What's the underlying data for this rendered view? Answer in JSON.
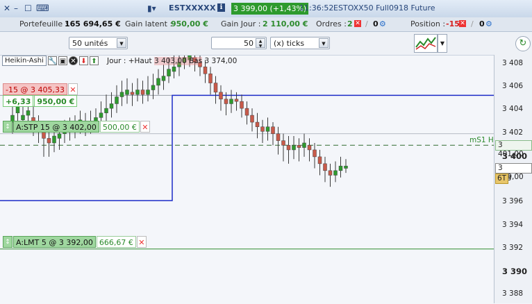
{
  "titlebar": {
    "close_glyph": "✕",
    "minimize_glyph": "–",
    "maximize_glyph": "☐",
    "keyboard_glyph": "⌨",
    "instrument": "ESTXXXXX",
    "info_glyph": "ℹ",
    "price": "3 399,00 (+1,43%)",
    "time": "11:36:52",
    "contract": "ESTOXX50 Full0918 Future"
  },
  "account": {
    "portfolio_label": "Portefeuille :",
    "portfolio_value": "165 694,65 €",
    "latent_label": "Gain latent :",
    "latent_value": "950,00 €",
    "day_label": "Gain Jour :",
    "day_value": "2 110,00 €",
    "orders_label": "Ordres :",
    "orders_pending": "2",
    "orders_done": "0",
    "position_label": "Position :",
    "position_value": "-15",
    "position_done": "0",
    "slash": "/"
  },
  "toolbar": {
    "timeframe_value": "50 unités",
    "ticks_value": "50",
    "ticks_mode": "(x) ticks"
  },
  "chart_header": {
    "style": "Heikin-Ashi",
    "ohlc_prefix": "Jour :",
    "ohlc_high": "+Haut",
    "ohlc_overlap": "3 403,00 Bas",
    "ohlc_low": "3 374,00"
  },
  "orders": {
    "position_tag": "-15 @ 3 405,33",
    "position_points": "+6,33",
    "position_gain": "950,00 €",
    "stop_label": "A:STP  15 @ 3 402,00",
    "stop_gain": "500,00 €",
    "limit_label": "A:LMT  5 @ 3 392,00",
    "limit_gain": "666,67 €"
  },
  "indicator_label": "mS1 H",
  "price_markers": {
    "ms1": "3 401,00",
    "last": "3 399,00",
    "timer": "6T"
  },
  "yaxis_ticks": [
    {
      "label": "3 408",
      "bold": false
    },
    {
      "label": "3 406",
      "bold": false
    },
    {
      "label": "3 404",
      "bold": false
    },
    {
      "label": "3 402",
      "bold": false
    },
    {
      "label": "3 400",
      "bold": true
    },
    {
      "label": "98",
      "bold": false
    },
    {
      "label": "3 396",
      "bold": false
    },
    {
      "label": "3 394",
      "bold": false
    },
    {
      "label": "3 392",
      "bold": false
    },
    {
      "label": "3 390",
      "bold": true
    },
    {
      "label": "3 388",
      "bold": false
    }
  ],
  "colors": {
    "up": "#2e9a2e",
    "down": "#c85a4a",
    "position_line": "#1c2cc8",
    "order_line": "#2e8b2e",
    "accent_green": "#2d9a2d"
  },
  "chart_data": {
    "type": "candlestick",
    "y_unit": "index points",
    "ylim": [
      3387.6,
      3409.0
    ],
    "candles": [
      {
        "o": 3403.0,
        "c": 3403.6,
        "h": 3404.6,
        "l": 3402.0
      },
      {
        "o": 3403.8,
        "c": 3404.4,
        "h": 3405.4,
        "l": 3402.6
      },
      {
        "o": 3403.2,
        "c": 3403.6,
        "h": 3404.8,
        "l": 3402.4
      },
      {
        "o": 3403.6,
        "c": 3404.0,
        "h": 3404.6,
        "l": 3402.6
      },
      {
        "o": 3403.4,
        "c": 3402.8,
        "h": 3404.4,
        "l": 3401.8
      },
      {
        "o": 3402.8,
        "c": 3402.2,
        "h": 3403.6,
        "l": 3401.2
      },
      {
        "o": 3402.2,
        "c": 3401.6,
        "h": 3403.0,
        "l": 3400.0
      },
      {
        "o": 3401.6,
        "c": 3401.2,
        "h": 3402.4,
        "l": 3400.0
      },
      {
        "o": 3401.2,
        "c": 3401.8,
        "h": 3402.8,
        "l": 3400.4
      },
      {
        "o": 3401.6,
        "c": 3402.0,
        "h": 3403.0,
        "l": 3400.6
      },
      {
        "o": 3402.0,
        "c": 3402.4,
        "h": 3403.2,
        "l": 3401.2
      },
      {
        "o": 3402.4,
        "c": 3402.6,
        "h": 3403.4,
        "l": 3401.4
      },
      {
        "o": 3402.6,
        "c": 3403.0,
        "h": 3403.6,
        "l": 3401.6
      },
      {
        "o": 3402.8,
        "c": 3403.2,
        "h": 3404.0,
        "l": 3402.0
      },
      {
        "o": 3403.0,
        "c": 3402.8,
        "h": 3403.8,
        "l": 3401.8
      },
      {
        "o": 3402.8,
        "c": 3403.0,
        "h": 3404.0,
        "l": 3402.0
      },
      {
        "o": 3403.0,
        "c": 3403.4,
        "h": 3404.2,
        "l": 3402.2
      },
      {
        "o": 3403.4,
        "c": 3403.8,
        "h": 3404.8,
        "l": 3402.6
      },
      {
        "o": 3403.8,
        "c": 3404.2,
        "h": 3405.4,
        "l": 3403.0
      },
      {
        "o": 3404.2,
        "c": 3404.6,
        "h": 3405.6,
        "l": 3403.4
      },
      {
        "o": 3404.6,
        "c": 3405.2,
        "h": 3406.2,
        "l": 3403.8
      },
      {
        "o": 3405.2,
        "c": 3405.6,
        "h": 3406.6,
        "l": 3404.4
      },
      {
        "o": 3405.4,
        "c": 3405.8,
        "h": 3406.8,
        "l": 3404.6
      },
      {
        "o": 3405.6,
        "c": 3405.4,
        "h": 3406.4,
        "l": 3404.4
      },
      {
        "o": 3405.4,
        "c": 3405.8,
        "h": 3406.8,
        "l": 3404.8
      },
      {
        "o": 3405.8,
        "c": 3405.4,
        "h": 3406.6,
        "l": 3404.6
      },
      {
        "o": 3405.4,
        "c": 3405.8,
        "h": 3407.0,
        "l": 3404.8
      },
      {
        "o": 3405.8,
        "c": 3406.2,
        "h": 3407.2,
        "l": 3405.0
      },
      {
        "o": 3406.2,
        "c": 3406.8,
        "h": 3407.6,
        "l": 3405.4
      },
      {
        "o": 3406.6,
        "c": 3407.0,
        "h": 3408.0,
        "l": 3405.8
      },
      {
        "o": 3407.0,
        "c": 3407.6,
        "h": 3408.6,
        "l": 3406.4
      },
      {
        "o": 3407.4,
        "c": 3407.8,
        "h": 3408.8,
        "l": 3406.8
      },
      {
        "o": 3407.8,
        "c": 3408.2,
        "h": 3409.0,
        "l": 3407.0
      },
      {
        "o": 3408.2,
        "c": 3408.6,
        "h": 3409.0,
        "l": 3407.6
      },
      {
        "o": 3408.4,
        "c": 3408.8,
        "h": 3409.0,
        "l": 3407.8
      },
      {
        "o": 3408.6,
        "c": 3408.2,
        "h": 3409.0,
        "l": 3407.4
      },
      {
        "o": 3408.2,
        "c": 3407.8,
        "h": 3408.8,
        "l": 3407.0
      },
      {
        "o": 3407.8,
        "c": 3407.2,
        "h": 3408.4,
        "l": 3406.4
      },
      {
        "o": 3407.2,
        "c": 3406.4,
        "h": 3407.8,
        "l": 3405.4
      },
      {
        "o": 3406.4,
        "c": 3405.6,
        "h": 3407.0,
        "l": 3404.6
      },
      {
        "o": 3405.6,
        "c": 3405.0,
        "h": 3406.2,
        "l": 3404.0
      },
      {
        "o": 3405.0,
        "c": 3404.6,
        "h": 3405.6,
        "l": 3403.6
      },
      {
        "o": 3404.6,
        "c": 3405.0,
        "h": 3405.8,
        "l": 3403.8
      },
      {
        "o": 3405.0,
        "c": 3404.8,
        "h": 3405.6,
        "l": 3404.0
      },
      {
        "o": 3404.8,
        "c": 3404.2,
        "h": 3405.4,
        "l": 3403.4
      },
      {
        "o": 3404.2,
        "c": 3403.6,
        "h": 3404.8,
        "l": 3402.8
      },
      {
        "o": 3403.6,
        "c": 3403.0,
        "h": 3404.2,
        "l": 3402.2
      },
      {
        "o": 3403.0,
        "c": 3402.6,
        "h": 3403.8,
        "l": 3401.6
      },
      {
        "o": 3402.6,
        "c": 3402.2,
        "h": 3403.2,
        "l": 3401.2
      },
      {
        "o": 3402.2,
        "c": 3402.6,
        "h": 3403.4,
        "l": 3401.4
      },
      {
        "o": 3402.6,
        "c": 3402.0,
        "h": 3403.0,
        "l": 3401.0
      },
      {
        "o": 3402.0,
        "c": 3401.4,
        "h": 3402.6,
        "l": 3400.2
      },
      {
        "o": 3401.4,
        "c": 3401.0,
        "h": 3402.0,
        "l": 3399.6
      },
      {
        "o": 3401.0,
        "c": 3400.6,
        "h": 3401.8,
        "l": 3399.4
      },
      {
        "o": 3400.6,
        "c": 3401.0,
        "h": 3401.8,
        "l": 3399.8
      },
      {
        "o": 3401.0,
        "c": 3400.8,
        "h": 3401.6,
        "l": 3399.6
      },
      {
        "o": 3400.8,
        "c": 3401.2,
        "h": 3402.0,
        "l": 3400.0
      },
      {
        "o": 3401.0,
        "c": 3400.6,
        "h": 3401.6,
        "l": 3399.6
      },
      {
        "o": 3400.6,
        "c": 3400.0,
        "h": 3401.2,
        "l": 3399.0
      },
      {
        "o": 3400.0,
        "c": 3399.4,
        "h": 3400.6,
        "l": 3398.4
      },
      {
        "o": 3399.4,
        "c": 3398.8,
        "h": 3400.0,
        "l": 3397.8
      },
      {
        "o": 3398.8,
        "c": 3398.4,
        "h": 3399.4,
        "l": 3397.4
      },
      {
        "o": 3398.4,
        "c": 3398.8,
        "h": 3399.6,
        "l": 3397.8
      },
      {
        "o": 3398.8,
        "c": 3399.2,
        "h": 3400.0,
        "l": 3398.2
      },
      {
        "o": 3399.0,
        "c": 3399.2,
        "h": 3399.8,
        "l": 3398.6
      }
    ],
    "position_line": 3405.33,
    "stop_line": 3402.0,
    "limit_line": 3392.0,
    "ms1_line": 3401.0,
    "blue_step_low": 3396.2,
    "axis_ticks": [
      3408,
      3406,
      3404,
      3402,
      3400,
      3398,
      3396,
      3394,
      3392,
      3390,
      3388
    ]
  }
}
